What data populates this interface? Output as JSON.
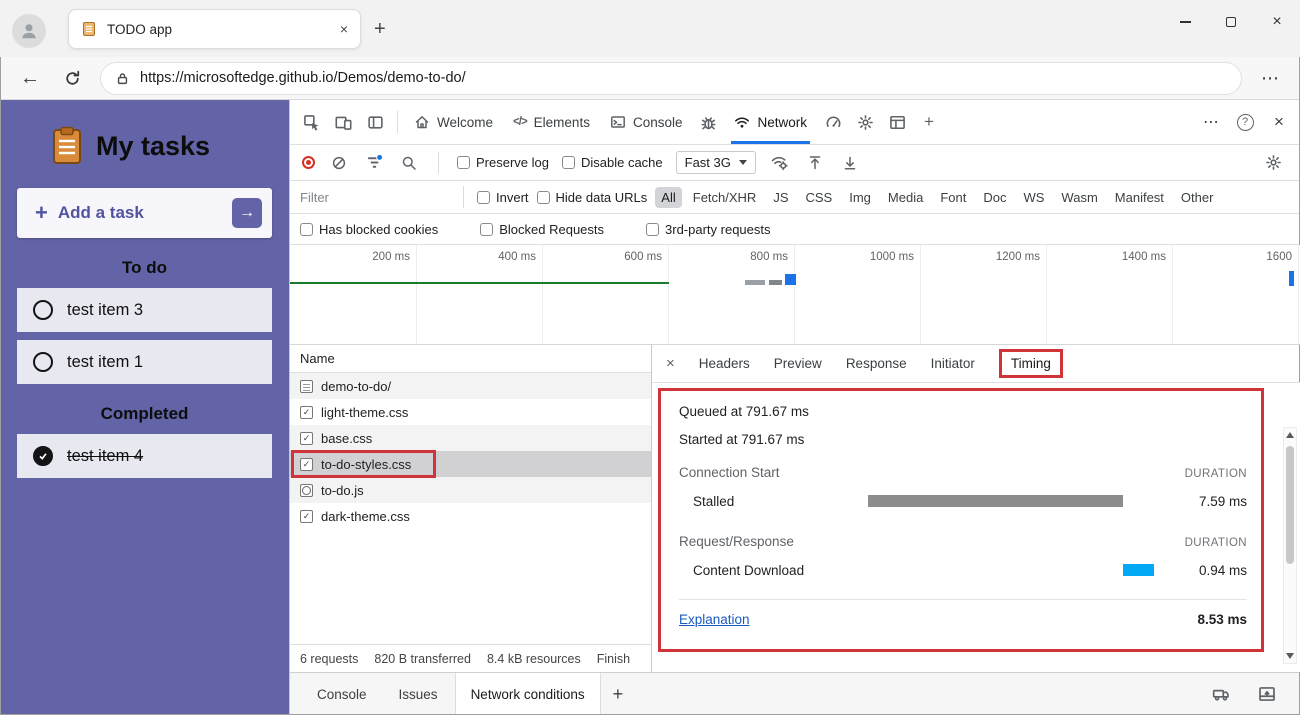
{
  "colors": {
    "app_purple": "#6264a7",
    "accent_blue": "#1a73e8",
    "annotation_red": "#d13438"
  },
  "icons": {
    "back": "←",
    "more_h": "⋯",
    "close": "×",
    "help": "?",
    "plus": "+",
    "elements_glyph": "</>",
    "arrow_right": "→"
  },
  "browser": {
    "tab_title": "TODO app",
    "url": "https://microsoftedge.github.io/Demos/demo-to-do/"
  },
  "todo": {
    "title": "My tasks",
    "add_task": "Add a task",
    "sections": [
      {
        "heading": "To do"
      },
      {
        "heading": "Completed"
      }
    ],
    "items": [
      {
        "label": "test item 3"
      },
      {
        "label": "test item 1"
      },
      {
        "label": "test item 4"
      }
    ]
  },
  "devtools": {
    "tabs": {
      "welcome": "Welcome",
      "elements": "Elements",
      "console": "Console",
      "network": "Network"
    },
    "network": {
      "toolbar": {
        "preserve_log": "Preserve log",
        "disable_cache": "Disable cache",
        "throttling": "Fast 3G"
      },
      "filter_placeholder": "Filter",
      "invert": "Invert",
      "hide_data_urls": "Hide data URLs",
      "pills": [
        "All",
        "Fetch/XHR",
        "JS",
        "CSS",
        "Img",
        "Media",
        "Font",
        "Doc",
        "WS",
        "Wasm",
        "Manifest",
        "Other"
      ],
      "active_pill": "All",
      "checks": [
        "Has blocked cookies",
        "Blocked Requests",
        "3rd-party requests"
      ],
      "overview_labels": [
        "200 ms",
        "400 ms",
        "600 ms",
        "800 ms",
        "1000 ms",
        "1200 ms",
        "1400 ms",
        "1600"
      ],
      "table": {
        "name_header": "Name",
        "requests": [
          {
            "name": "demo-to-do/",
            "icon": "document"
          },
          {
            "name": "light-theme.css",
            "icon": "stylesheet"
          },
          {
            "name": "base.css",
            "icon": "stylesheet"
          },
          {
            "name": "to-do-styles.css",
            "icon": "stylesheet"
          },
          {
            "name": "to-do.js",
            "icon": "script"
          },
          {
            "name": "dark-theme.css",
            "icon": "stylesheet"
          }
        ],
        "selected_request": "to-do-styles.css"
      },
      "status": [
        "6 requests",
        "820 B transferred",
        "8.4 kB resources",
        "Finish"
      ],
      "detail": {
        "tabs": [
          "Headers",
          "Preview",
          "Response",
          "Initiator",
          "Timing"
        ],
        "active_tab": "Timing",
        "timing": {
          "queued": "Queued at 791.67 ms",
          "started": "Started at 791.67 ms",
          "connection_title": "Connection Start",
          "request_title": "Request/Response",
          "duration_header": "DURATION",
          "stalled_label": "Stalled",
          "stalled_duration": "7.59 ms",
          "stalled_color": "#8d8d8d",
          "download_label": "Content Download",
          "download_duration": "0.94 ms",
          "download_color": "#03a9f4",
          "explanation": "Explanation",
          "total": "8.53 ms"
        }
      }
    },
    "drawer": {
      "tabs": [
        "Console",
        "Issues",
        "Network conditions"
      ],
      "active_tab": "Network conditions"
    }
  }
}
